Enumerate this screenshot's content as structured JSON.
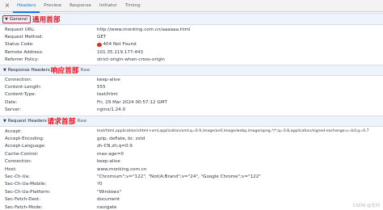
{
  "tabs": {
    "close_glyph": "×",
    "items": [
      {
        "label": "Headers",
        "active": true
      },
      {
        "label": "Preview",
        "active": false
      },
      {
        "label": "Response",
        "active": false
      },
      {
        "label": "Initiator",
        "active": false
      },
      {
        "label": "Timing",
        "active": false
      }
    ]
  },
  "general": {
    "title": "General",
    "annotation": "通用首部",
    "rows": [
      {
        "key": "Request URL:",
        "value": "http://www.monking.com.cn/aaaaaa.html"
      },
      {
        "key": "Request Method:",
        "value": "GET"
      },
      {
        "key": "Status Code:",
        "value": "404 Not Found"
      },
      {
        "key": "Remote Address:",
        "value": "101.35.119.177:443"
      },
      {
        "key": "Referrer Policy:",
        "value": "strict-origin-when-cross-origin"
      }
    ]
  },
  "response_headers": {
    "title": "Response Headers",
    "annotation": "响应首部",
    "raw_label": "Raw",
    "rows": [
      {
        "key": "Connection:",
        "value": "keep-alive"
      },
      {
        "key": "Content-Length:",
        "value": "555"
      },
      {
        "key": "Content-Type:",
        "value": "text/html"
      },
      {
        "key": "Date:",
        "value": "Fri, 29 Mar 2024 00:57:12 GMT"
      },
      {
        "key": "Server:",
        "value": "nginx/1.24.0"
      }
    ]
  },
  "request_headers": {
    "title": "Request Headers",
    "annotation": "请求首部",
    "raw_label": "Raw",
    "rows": [
      {
        "key": "Accept:",
        "value": "text/html,application/xhtml+xml,application/xml;q=0.9,image/avif,image/webp,image/apng,*/*;q=0.8,application/signed-exchange;v=b3;q=0.7"
      },
      {
        "key": "Accept-Encoding:",
        "value": "gzip, deflate, br, zstd"
      },
      {
        "key": "Accept-Language:",
        "value": "zh-CN,zh;q=0.9"
      },
      {
        "key": "Cache-Control:",
        "value": "max-age=0"
      },
      {
        "key": "Connection:",
        "value": "keep-alive"
      },
      {
        "key": "Host:",
        "value": "www.monking.com.cn"
      },
      {
        "key": "Sec-Ch-Ua:",
        "value": "\"Chromium\";v=\"122\", \"Not(A:Brand\";v=\"24\", \"Google Chrome\";v=\"122\""
      },
      {
        "key": "Sec-Ch-Ua-Mobile:",
        "value": "?0"
      },
      {
        "key": "Sec-Ch-Ua-Platform:",
        "value": "\"Windows\""
      },
      {
        "key": "Sec-Fetch-Dest:",
        "value": "document"
      },
      {
        "key": "Sec-Fetch-Mode:",
        "value": "navigate"
      }
    ]
  },
  "watermark": "CSDN @无问",
  "colors": {
    "accent": "#1a73e8",
    "annotation_red": "#e8111c",
    "section_bg": "#edf2fb",
    "error_dot": "#d93025"
  }
}
